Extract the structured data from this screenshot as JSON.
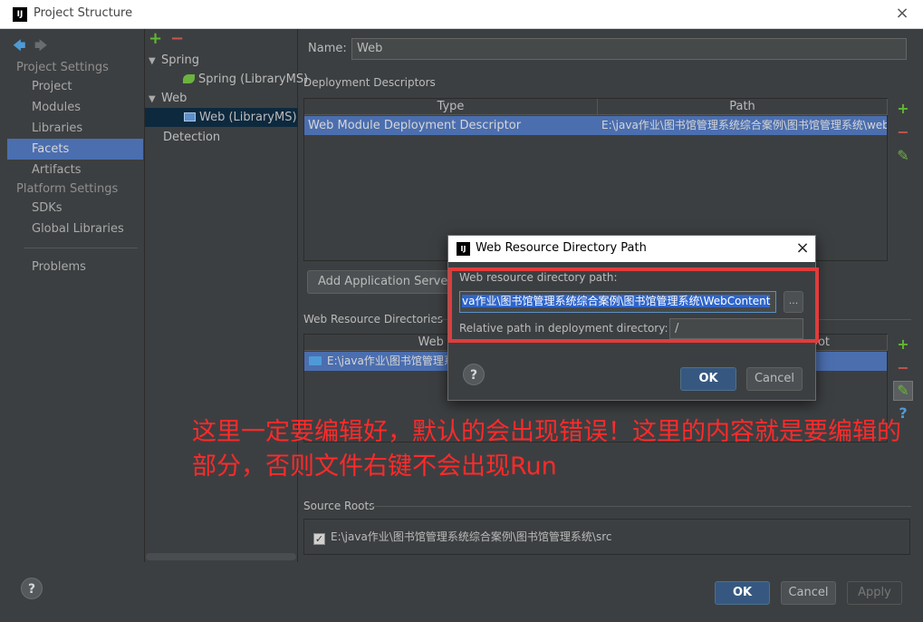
{
  "window": {
    "title": "Project Structure",
    "logo": "IJ",
    "close": "×"
  },
  "nav": {
    "back": "🡄",
    "forward": "🡆",
    "project_settings": "Project Settings",
    "platform_settings": "Platform Settings",
    "items_project": [
      "Project",
      "Modules",
      "Libraries",
      "Facets",
      "Artifacts"
    ],
    "items_platform": [
      "SDKs",
      "Global Libraries"
    ],
    "problems": "Problems",
    "selected": "Facets"
  },
  "tree": {
    "add": "+",
    "remove": "−",
    "spring_group": "Spring",
    "spring_item": "Spring (LibraryMS)",
    "web_group": "Web",
    "web_item": "Web (LibraryMS)",
    "detection": "Detection"
  },
  "facet": {
    "name_label": "Name:",
    "name_value": "Web",
    "deployment_descriptors_label": "Deployment Descriptors",
    "dd_columns": [
      "Type",
      "Path"
    ],
    "dd_row_type": "Web Module Deployment Descriptor",
    "dd_row_path": "E:\\java作业\\图书馆管理系统综合案例\\图书馆管理系统\\web\\",
    "add_server_button": "Add Application Server s",
    "web_resource_dirs_label": "Web Resource Directories",
    "wrd_col_1": "Web Resou",
    "wrd_col_2": "oot",
    "wrd_row": "E:\\java作业\\图书馆管理系",
    "source_roots_label": "Source Roots",
    "source_root": "E:\\java作业\\图书馆管理系统综合案例\\图书馆管理系统\\src"
  },
  "side_buttons": {
    "add": "+",
    "remove": "−",
    "edit": "✎",
    "help": "?"
  },
  "modal": {
    "logo": "IJ",
    "title": "Web Resource Directory Path",
    "close": "×",
    "path_label": "Web resource directory path:",
    "path_value": "va作业\\图书馆管理系统综合案例\\图书馆管理系统\\WebContent",
    "browse": "...",
    "relative_label": "Relative path in deployment directory:",
    "relative_value": "/",
    "ok": "OK",
    "cancel": "Cancel",
    "help": "?"
  },
  "annotation": "这里一定要编辑好，默认的会出现错误！这里的内容就是要编辑的部分，否则文件右键不会出现Run",
  "footer": {
    "help": "?",
    "ok": "OK",
    "cancel": "Cancel",
    "apply": "Apply"
  },
  "colors": {
    "accent": "#4b6eaf",
    "annotation_red": "#e23b3b",
    "plus_green": "#5fb832",
    "minus_red": "#c75450"
  }
}
